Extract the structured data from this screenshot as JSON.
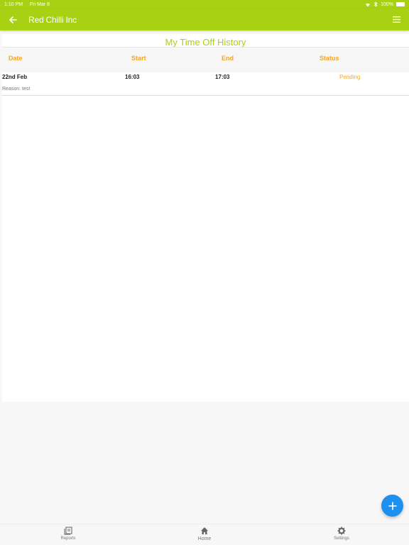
{
  "status_bar": {
    "time": "1:10 PM",
    "date": "Fri Mar 8",
    "battery": "100%"
  },
  "nav": {
    "title": "Red Chilli Inc"
  },
  "page": {
    "title": "My Time Off History"
  },
  "table": {
    "headers": {
      "date": "Date",
      "start": "Start",
      "end": "End",
      "status": "Status"
    },
    "rows": [
      {
        "date": "22nd Feb",
        "start": "16:03",
        "end": "17:03",
        "status": "Pending",
        "reason": "Reason: test"
      }
    ]
  },
  "fab": {
    "icon": "plus-icon"
  },
  "tabs": [
    {
      "label": "Reports",
      "icon": "reports-icon"
    },
    {
      "label": "Home",
      "icon": "home-icon"
    },
    {
      "label": "Settings",
      "icon": "gear-icon"
    }
  ],
  "colors": {
    "accent": "#a8d113",
    "status": "#f5a524",
    "fab": "#1e90f0"
  }
}
